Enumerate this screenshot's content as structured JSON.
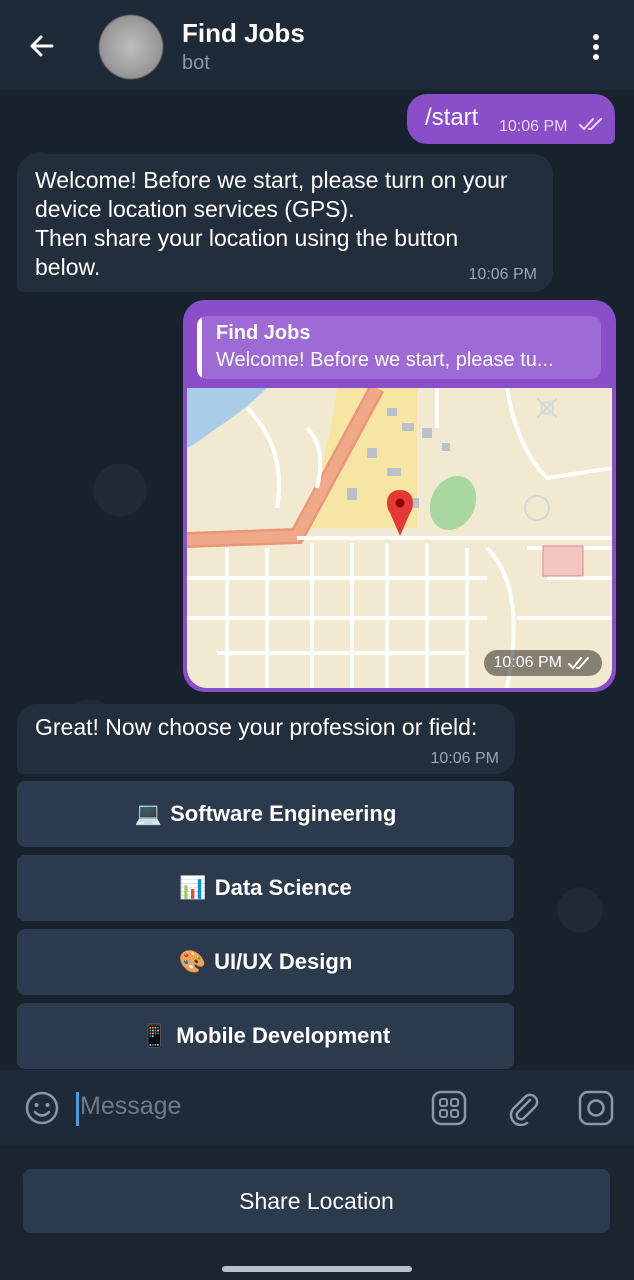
{
  "header": {
    "title": "Find Jobs",
    "subtitle": "bot"
  },
  "messages": {
    "start": {
      "text": "/start",
      "time": "10:06 PM"
    },
    "welcome": {
      "text": "Welcome! Before we start, please turn on your device location services (GPS). Then share your location using the button below.",
      "line1": "Welcome! Before we start, please turn on your",
      "line2": "device location services (GPS).",
      "line3": "Then share your location using the button",
      "line4": "below.",
      "time": "10:06 PM"
    },
    "location": {
      "reply_name": "Find Jobs",
      "reply_text": "Welcome! Before we start, please tu...",
      "time": "10:06 PM"
    },
    "great": {
      "text": "Great! Now choose your profession or field:",
      "time": "10:06 PM"
    }
  },
  "keyboard_buttons": [
    {
      "emoji": "💻",
      "label": "Software Engineering"
    },
    {
      "emoji": "📊",
      "label": "Data Science"
    },
    {
      "emoji": "🎨",
      "label": "UI/UX Design"
    },
    {
      "emoji": "📱",
      "label": "Mobile Development"
    }
  ],
  "input": {
    "placeholder": "Message"
  },
  "reply_keyboard": {
    "share_location": "Share Location"
  },
  "colors": {
    "outgoing_bubble": "#8a4fc8",
    "incoming_bubble": "#222e3c",
    "header": "#1e2a38",
    "button": "#2c3a4d"
  },
  "icons": [
    "back-arrow-icon",
    "more-vert-icon",
    "double-check-icon",
    "map-pin-icon",
    "emoji-icon",
    "bot-commands-icon",
    "attach-icon",
    "camera-icon"
  ]
}
